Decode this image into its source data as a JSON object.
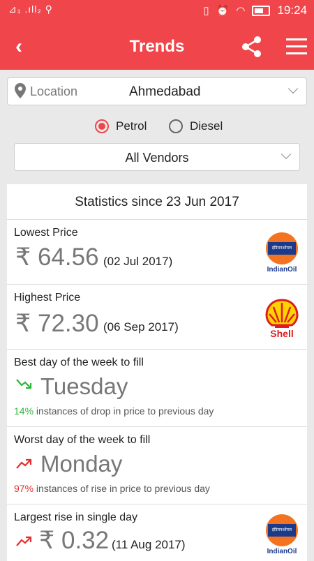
{
  "statusbar": {
    "left": "⊿₁ .ıll₂ ⚲",
    "time": "19:24"
  },
  "appbar": {
    "title": "Trends"
  },
  "location": {
    "label": "Location",
    "value": "Ahmedabad"
  },
  "fuel": {
    "petrol": "Petrol",
    "diesel": "Diesel",
    "selected": "Petrol"
  },
  "vendor": {
    "selected": "All Vendors"
  },
  "stats": {
    "header": "Statistics since 23 Jun 2017",
    "lowest": {
      "label": "Lowest Price",
      "price": "₹ 64.56",
      "date": "(02 Jul 2017)",
      "brand": "IndianOil"
    },
    "highest": {
      "label": "Highest Price",
      "price": "₹ 72.30",
      "date": "(06 Sep 2017)",
      "brand": "Shell"
    },
    "best_day": {
      "label": "Best day of the week to fill",
      "day": "Tuesday",
      "pct": "14%",
      "note": " instances of drop in price to previous day"
    },
    "worst_day": {
      "label": "Worst day of the week to fill",
      "day": "Monday",
      "pct": "97%",
      "note": " instances of rise in price to previous day"
    },
    "largest_rise": {
      "label": "Largest rise in single day",
      "price": "₹ 0.32",
      "date": "(11 Aug 2017)",
      "brand": "IndianOil"
    }
  },
  "colors": {
    "accent": "#f0454a",
    "green": "#2bb73a",
    "red": "#e82d2d"
  }
}
